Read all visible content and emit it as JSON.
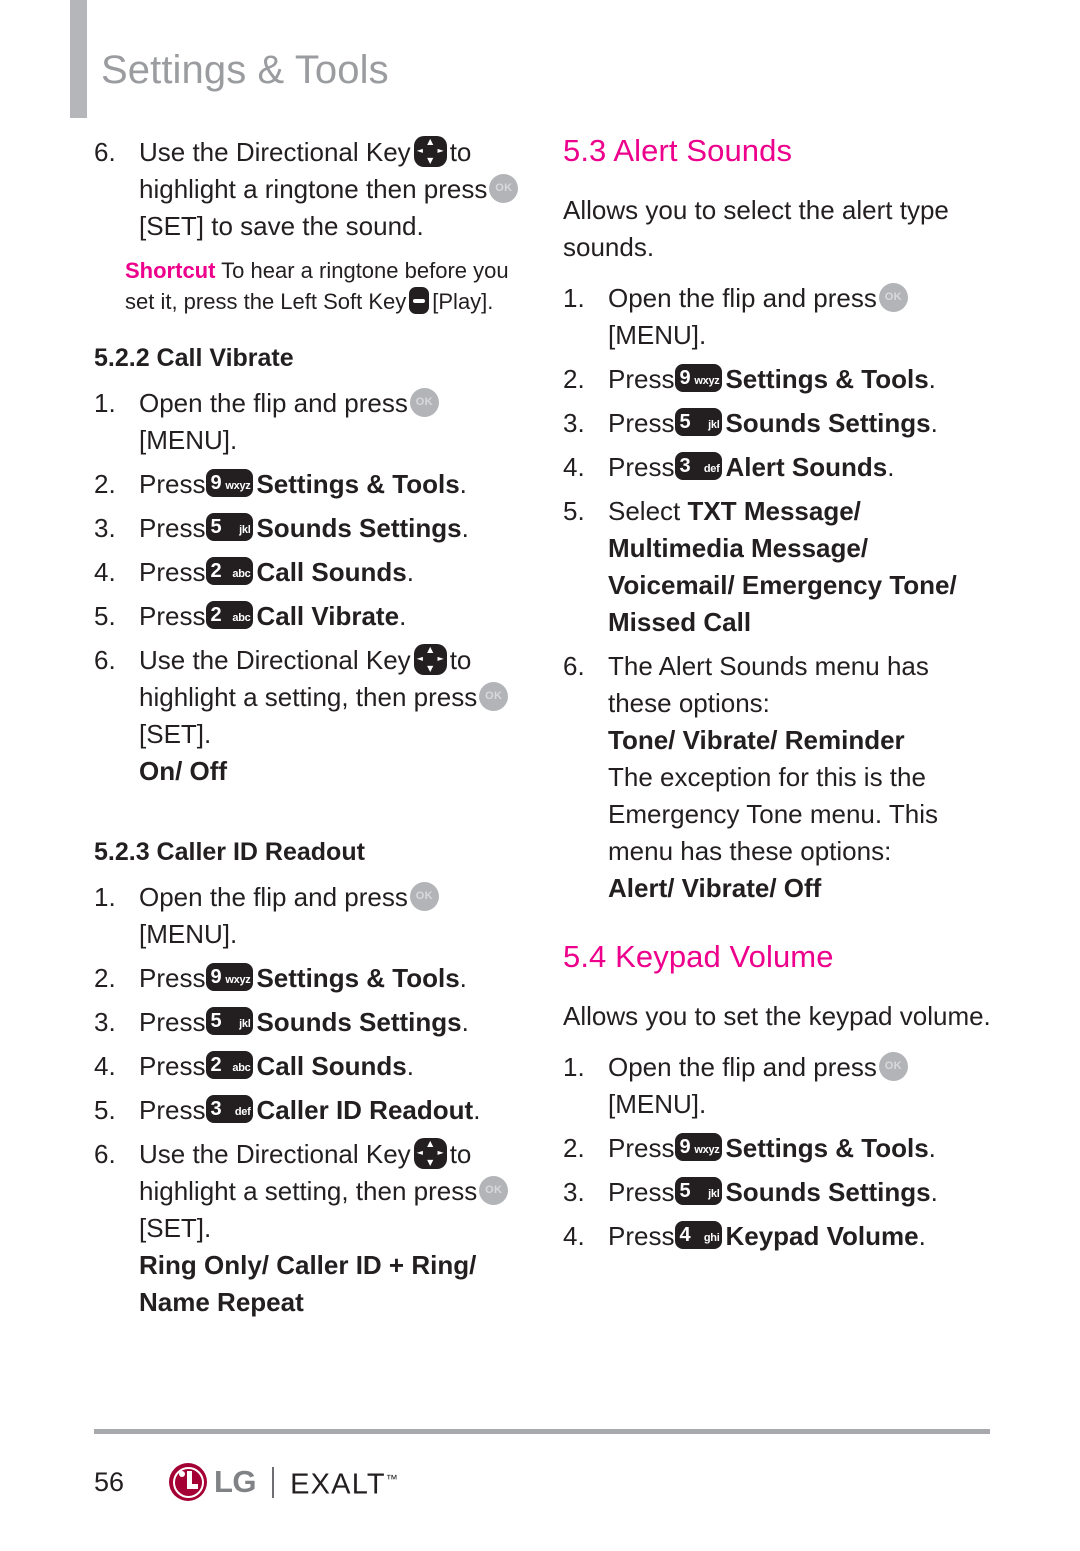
{
  "header": {
    "title": "Settings & Tools",
    "accent_bar_color": "#b4b6b9",
    "title_color": "#9a9c9f"
  },
  "colors": {
    "accent_pink": "#ec008c",
    "text": "#231f20",
    "key_dark": "#231f20",
    "ok_key_gray": "#b2b4b7",
    "lg_red": "#a50034"
  },
  "icons": {
    "ok_key": {
      "name": "ok-key-icon",
      "label": "OK"
    },
    "directional_key": {
      "name": "directional-key-icon",
      "up": "▲",
      "down": "▼",
      "left": "◄",
      "right": "►"
    },
    "left_soft_key": {
      "name": "left-soft-key-icon"
    },
    "key_2abc": {
      "name": "keypad-key-2-icon",
      "digit": "2",
      "letters": "abc"
    },
    "key_3def": {
      "name": "keypad-key-3-icon",
      "digit": "3",
      "letters": "def"
    },
    "key_4ghi": {
      "name": "keypad-key-4-icon",
      "digit": "4",
      "letters": "ghi"
    },
    "key_5jkl": {
      "name": "keypad-key-5-icon",
      "digit": "5",
      "letters": "jkl"
    },
    "key_9wxyz": {
      "name": "keypad-key-9-icon",
      "digit": "9",
      "letters": "wxyz"
    }
  },
  "left_column": {
    "cont_step": {
      "num": "6.",
      "t1": "Use the Directional Key",
      "t2": "to highlight a ringtone then press",
      "t3": "[SET] to save the sound."
    },
    "shortcut": {
      "tag": "Shortcut",
      "t1": "To hear a ringtone before you set it, press the Left Soft Key",
      "t2": "[Play]."
    },
    "section_522": {
      "heading": "5.2.2 Call Vibrate",
      "steps": [
        {
          "num": "1.",
          "t1": "Open the flip and press",
          "t2": "[MENU]."
        },
        {
          "num": "2.",
          "t1": "Press",
          "bold": "Settings & Tools",
          "end": "."
        },
        {
          "num": "3.",
          "t1": "Press",
          "bold": "Sounds Settings",
          "end": "."
        },
        {
          "num": "4.",
          "t1": "Press",
          "bold": "Call Sounds",
          "end": "."
        },
        {
          "num": "5.",
          "t1": "Press",
          "bold": "Call Vibrate",
          "end": "."
        },
        {
          "num": "6.",
          "t1": "Use the Directional Key",
          "t2": "to highlight a setting, then press",
          "t3": "[SET].",
          "options": "On/ Off"
        }
      ]
    },
    "section_523": {
      "heading": "5.2.3 Caller ID Readout",
      "steps": [
        {
          "num": "1.",
          "t1": "Open the flip and press",
          "t2": "[MENU]."
        },
        {
          "num": "2.",
          "t1": "Press",
          "bold": "Settings & Tools",
          "end": "."
        },
        {
          "num": "3.",
          "t1": "Press",
          "bold": "Sounds Settings",
          "end": "."
        },
        {
          "num": "4.",
          "t1": "Press",
          "bold": "Call Sounds",
          "end": "."
        },
        {
          "num": "5.",
          "t1": "Press",
          "bold": "Caller ID Readout",
          "end": "."
        },
        {
          "num": "6.",
          "t1": "Use the Directional Key",
          "t2": "to highlight a setting, then press",
          "t3": "[SET].",
          "options": "Ring Only/ Caller ID + Ring/ Name Repeat"
        }
      ]
    }
  },
  "right_column": {
    "section_53": {
      "heading": "5.3 Alert Sounds",
      "intro": "Allows you to select the alert type sounds.",
      "steps": [
        {
          "num": "1.",
          "t1": "Open the flip and press",
          "t2": "[MENU]."
        },
        {
          "num": "2.",
          "t1": "Press",
          "bold": "Settings & Tools",
          "end": "."
        },
        {
          "num": "3.",
          "t1": "Press",
          "bold": "Sounds Settings",
          "end": "."
        },
        {
          "num": "4.",
          "t1": "Press",
          "bold": "Alert Sounds",
          "end": "."
        },
        {
          "num": "5.",
          "t1": "Select",
          "bold": "TXT Message/ Multimedia Message/ Voicemail/ Emergency Tone/ Missed Call"
        },
        {
          "num": "6.",
          "t1": "The Alert Sounds menu has these options:",
          "bold1": "Tone/ Vibrate/ Reminder",
          "t2": "The exception for this is the Emergency Tone menu. This menu has these options:",
          "bold2": "Alert/ Vibrate/ Off"
        }
      ]
    },
    "section_54": {
      "heading": "5.4 Keypad Volume",
      "intro": "Allows you to set the keypad volume.",
      "steps": [
        {
          "num": "1.",
          "t1": "Open the flip and press",
          "t2": "[MENU]."
        },
        {
          "num": "2.",
          "t1": "Press",
          "bold": "Settings & Tools",
          "end": "."
        },
        {
          "num": "3.",
          "t1": "Press",
          "bold": "Sounds Settings",
          "end": "."
        },
        {
          "num": "4.",
          "t1": "Press",
          "bold": "Keypad Volume",
          "end": "."
        }
      ]
    }
  },
  "footer": {
    "page_number": "56",
    "brand": "LG",
    "divider": "|",
    "model": "EXALT",
    "trademark": "™"
  }
}
